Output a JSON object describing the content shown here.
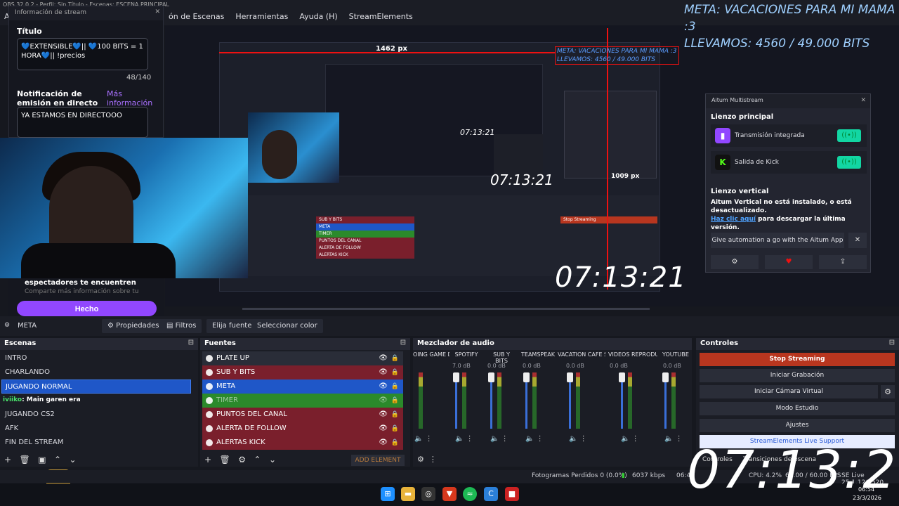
{
  "window": {
    "title": "OBS 32.0.2 - Perfil: Sin Título - Escenas: ESCENA PRINCIPAL",
    "menu": [
      "Ar",
      "ón de Escenas",
      "Herramientas",
      "Ayuda (H)",
      "StreamElements"
    ]
  },
  "overlay": {
    "meta_line1": "META: VACACIONES PARA MI MAMA :3",
    "meta_line2": "LLEVAMOS: 4560 / 49.000 BITS",
    "clock": "07:13:21",
    "preview_width_label": "1462 px",
    "preview_height_label": "1009 px"
  },
  "stream_info": {
    "header": "Información de stream",
    "title_label": "Título",
    "title_value": "💙EXTENSIBLE💙|| 💙100 BITS = 1 HORA💙|| !precios",
    "char_count": "48/140",
    "notif_label": "Notificación de emisión en directo",
    "more_info": "Más información",
    "notif_value": "YA ESTAMOS EN DIRECTOOO",
    "partial_text1": "espectadores te encuentren",
    "partial_text2": "Comparte más información sobre tu",
    "done_button": "Hecho"
  },
  "aitum": {
    "title": "Aitum Multistream",
    "main_section": "Lienzo principal",
    "rows": [
      {
        "name": "Transmisión integrada",
        "logo": "twitch-logo",
        "color": "#9147ff"
      },
      {
        "name": "Salida de Kick",
        "logo": "kick-logo",
        "color": "#111111"
      }
    ],
    "vertical_section": "Lienzo vertical",
    "vertical_warning": "Aitum Vertical no está instalado, o está desactualizado.",
    "click_here": "Haz clic aquí",
    "download_text": "para descargar la última versión.",
    "give_automation": "Give automation a go with the Aitum App",
    "close": "✕"
  },
  "source_toolbar": {
    "source_name": "META",
    "properties": "Propiedades",
    "filters": "Filtros",
    "pick_source": "Elija fuente",
    "select_color": "Seleccionar color"
  },
  "scenes": {
    "title": "Escenas",
    "items": [
      "INTRO",
      "CHARLANDO",
      "JUGANDO NORMAL",
      "",
      "JUGANDO CS2",
      "AFK",
      "FIN DEL STREAM"
    ],
    "selected": "JUGANDO NORMAL"
  },
  "chat_overlay": {
    "user": "iviiko",
    "message": ": Main garen era"
  },
  "sources": {
    "title": "Fuentes",
    "items": [
      {
        "name": "PLATE UP",
        "color": "#2a2d38"
      },
      {
        "name": "SUB Y BITS",
        "color": "#7a1f2c"
      },
      {
        "name": "META",
        "color": "#1f57c8"
      },
      {
        "name": "TIMER",
        "color": "#2b8a2b"
      },
      {
        "name": "PUNTOS DEL CANAL",
        "color": "#7a1f2c"
      },
      {
        "name": "ALERTA DE FOLLOW",
        "color": "#7a1f2c"
      },
      {
        "name": "ALERTAS KICK",
        "color": "#7a1f2c"
      }
    ],
    "add_element": "ADD ELEMENT"
  },
  "mixer": {
    "title": "Mezclador de audio",
    "channels": [
      {
        "name": "OING GAME DI",
        "db": ""
      },
      {
        "name": "SPOTIFY",
        "db": "7.0 dB"
      },
      {
        "name": "SUB Y BITS",
        "db": "0.0 dB"
      },
      {
        "name": "TEAMSPEAK",
        "db": "0.0 dB"
      },
      {
        "name": "VACATION CAFE SI",
        "db": "0.0 dB"
      },
      {
        "name": "VIDEOS REPRODUC",
        "db": "0.0 dB"
      },
      {
        "name": "YOUTUBE",
        "db": "0.0 dB"
      }
    ]
  },
  "controls": {
    "title": "Controles",
    "stop_streaming": "Stop Streaming",
    "start_recording": "Iniciar Grabación",
    "start_virtual_camera": "Iniciar Cámara Virtual",
    "studio_mode": "Modo Estudio",
    "settings": "Ajustes",
    "live_support": "StreamElements Live Support",
    "tab_controls": "Controles",
    "tab_transitions": "Transiciones de escena"
  },
  "status": {
    "frames_lost": "Fotogramas Perdidos 0 (0.0%)",
    "bitrate": "6037 kbps",
    "stream_time": "06:4",
    "cpu": "CPU: 4.2%",
    "fps": "60.00 / 60.00 FPS",
    "session": "SE Live 25.1.126.520"
  },
  "taskbar": {
    "time": "06:54",
    "date": "23/3/2026"
  },
  "colors": {
    "accent_twitch": "#9147ff",
    "stop_streaming": "#b8361f",
    "selection": "#1f57c8",
    "aitum_toggle": "#12d6a3"
  }
}
